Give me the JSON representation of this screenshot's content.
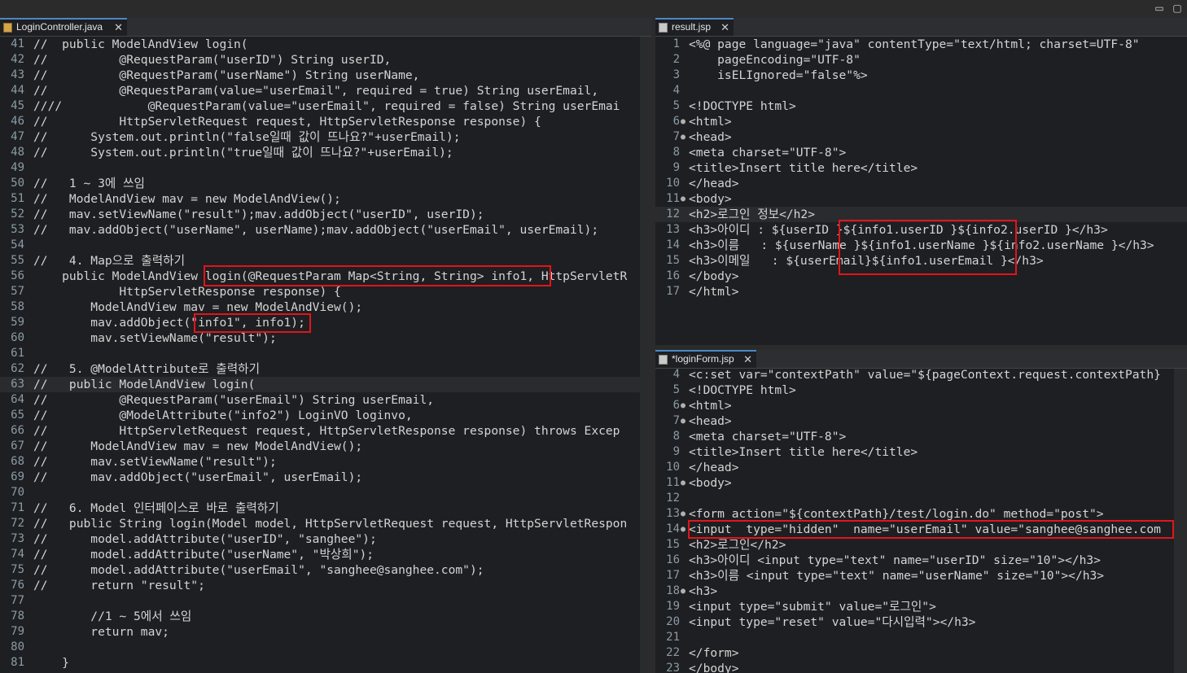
{
  "window": {
    "minimize_icon": "▭",
    "maximize_icon": "▢"
  },
  "left": {
    "tab": {
      "label": "LoginController.java",
      "close": "✕"
    },
    "lines": [
      {
        "n": "41",
        "t": "//  public ModelAndView login("
      },
      {
        "n": "42",
        "t": "//          @RequestParam(\"userID\") String userID,"
      },
      {
        "n": "43",
        "t": "//          @RequestParam(\"userName\") String userName,"
      },
      {
        "n": "44",
        "t": "//          @RequestParam(value=\"userEmail\", required = true) String userEmail,"
      },
      {
        "n": "45",
        "t": "////            @RequestParam(value=\"userEmail\", required = false) String userEmai"
      },
      {
        "n": "46",
        "t": "//          HttpServletRequest request, HttpServletResponse response) {"
      },
      {
        "n": "47",
        "t": "//      System.out.println(\"false일때 값이 뜨나요?\"+userEmail);"
      },
      {
        "n": "48",
        "t": "//      System.out.println(\"true일때 값이 뜨나요?\"+userEmail);"
      },
      {
        "n": "49",
        "t": ""
      },
      {
        "n": "50",
        "t": "//   1 ~ 3에 쓰임"
      },
      {
        "n": "51",
        "t": "//   ModelAndView mav = new ModelAndView();"
      },
      {
        "n": "52",
        "t": "//   mav.setViewName(\"result\");mav.addObject(\"userID\", userID);"
      },
      {
        "n": "53",
        "t": "//   mav.addObject(\"userName\", userName);mav.addObject(\"userEmail\", userEmail);"
      },
      {
        "n": "54",
        "t": ""
      },
      {
        "n": "55",
        "t": "//   4. Map으로 출력하기"
      },
      {
        "n": "56",
        "t": "    public ModelAndView login(@RequestParam Map<String, String> info1, HttpServletR"
      },
      {
        "n": "57",
        "t": "            HttpServletResponse response) {"
      },
      {
        "n": "58",
        "t": "        ModelAndView mav = new ModelAndView();"
      },
      {
        "n": "59",
        "t": "        mav.addObject(\"info1\", info1);"
      },
      {
        "n": "60",
        "t": "        mav.setViewName(\"result\");"
      },
      {
        "n": "61",
        "t": ""
      },
      {
        "n": "62",
        "t": "//   5. @ModelAttribute로 출력하기"
      },
      {
        "n": "63",
        "t": "//   public ModelAndView login("
      },
      {
        "n": "64",
        "t": "//          @RequestParam(\"userEmail\") String userEmail,"
      },
      {
        "n": "65",
        "t": "//          @ModelAttribute(\"info2\") LoginVO loginvo,"
      },
      {
        "n": "66",
        "t": "//          HttpServletRequest request, HttpServletResponse response) throws Excep"
      },
      {
        "n": "67",
        "t": "//      ModelAndView mav = new ModelAndView();"
      },
      {
        "n": "68",
        "t": "//      mav.setViewName(\"result\");"
      },
      {
        "n": "69",
        "t": "//      mav.addObject(\"userEmail\", userEmail);"
      },
      {
        "n": "70",
        "t": ""
      },
      {
        "n": "71",
        "t": "//   6. Model 인터페이스로 바로 출력하기"
      },
      {
        "n": "72",
        "t": "//   public String login(Model model, HttpServletRequest request, HttpServletRespon"
      },
      {
        "n": "73",
        "t": "//      model.addAttribute(\"userID\", \"sanghee\");"
      },
      {
        "n": "74",
        "t": "//      model.addAttribute(\"userName\", \"박상희\");"
      },
      {
        "n": "75",
        "t": "//      model.addAttribute(\"userEmail\", \"sanghee@sanghee.com\");"
      },
      {
        "n": "76",
        "t": "//      return \"result\";"
      },
      {
        "n": "77",
        "t": ""
      },
      {
        "n": "78",
        "t": "        //1 ~ 5에서 쓰임"
      },
      {
        "n": "79",
        "t": "        return mav;"
      },
      {
        "n": "80",
        "t": ""
      },
      {
        "n": "81",
        "t": "    }"
      }
    ]
  },
  "right_top": {
    "tab": {
      "label": "result.jsp",
      "close": "✕"
    },
    "lines": [
      {
        "n": "1",
        "t": "<%@ page language=\"java\" contentType=\"text/html; charset=UTF-8\""
      },
      {
        "n": "2",
        "t": "    pageEncoding=\"UTF-8\""
      },
      {
        "n": "3",
        "t": "    isELIgnored=\"false\"%>"
      },
      {
        "n": "4",
        "t": ""
      },
      {
        "n": "5",
        "t": "<!DOCTYPE html>"
      },
      {
        "n": "6",
        "t": "<html>"
      },
      {
        "n": "7",
        "t": "<head>"
      },
      {
        "n": "8",
        "t": "<meta charset=\"UTF-8\">"
      },
      {
        "n": "9",
        "t": "<title>Insert title here</title>"
      },
      {
        "n": "10",
        "t": "</head>"
      },
      {
        "n": "11",
        "t": "<body>"
      },
      {
        "n": "12",
        "t": "<h2>로그인 정보</h2>"
      },
      {
        "n": "13",
        "t": "<h3>아이디 : ${userID }${info1.userID }${info2.userID }</h3>"
      },
      {
        "n": "14",
        "t": "<h3>이름   : ${userName }${info1.userName }${info2.userName }</h3>"
      },
      {
        "n": "15",
        "t": "<h3>이메일   : ${userEmail}${info1.userEmail }</h3>"
      },
      {
        "n": "16",
        "t": "</body>"
      },
      {
        "n": "17",
        "t": "</html>"
      }
    ]
  },
  "right_bottom": {
    "tab": {
      "label": "*loginForm.jsp",
      "close": "✕"
    },
    "lines": [
      {
        "n": "4",
        "t": "<c:set var=\"contextPath\" value=\"${pageContext.request.contextPath}"
      },
      {
        "n": "5",
        "t": "<!DOCTYPE html>"
      },
      {
        "n": "6",
        "t": "<html>"
      },
      {
        "n": "7",
        "t": "<head>"
      },
      {
        "n": "8",
        "t": "<meta charset=\"UTF-8\">"
      },
      {
        "n": "9",
        "t": "<title>Insert title here</title>"
      },
      {
        "n": "10",
        "t": "</head>"
      },
      {
        "n": "11",
        "t": "<body>"
      },
      {
        "n": "12",
        "t": ""
      },
      {
        "n": "13",
        "t": "<form action=\"${contextPath}/test/login.do\" method=\"post\">"
      },
      {
        "n": "14",
        "t": "<input  type=\"hidden\"  name=\"userEmail\" value=\"sanghee@sanghee.com"
      },
      {
        "n": "15",
        "t": "<h2>로그인</h2>"
      },
      {
        "n": "16",
        "t": "<h3>아이디 <input type=\"text\" name=\"userID\" size=\"10\"></h3>"
      },
      {
        "n": "17",
        "t": "<h3>이름 <input type=\"text\" name=\"userName\" size=\"10\"></h3>"
      },
      {
        "n": "18",
        "t": "<h3>"
      },
      {
        "n": "19",
        "t": "<input type=\"submit\" value=\"로그인\">"
      },
      {
        "n": "20",
        "t": "<input type=\"reset\" value=\"다시입력\"></h3>"
      },
      {
        "n": "21",
        "t": ""
      },
      {
        "n": "22",
        "t": "</form>"
      },
      {
        "n": "23",
        "t": "</body>"
      }
    ]
  }
}
